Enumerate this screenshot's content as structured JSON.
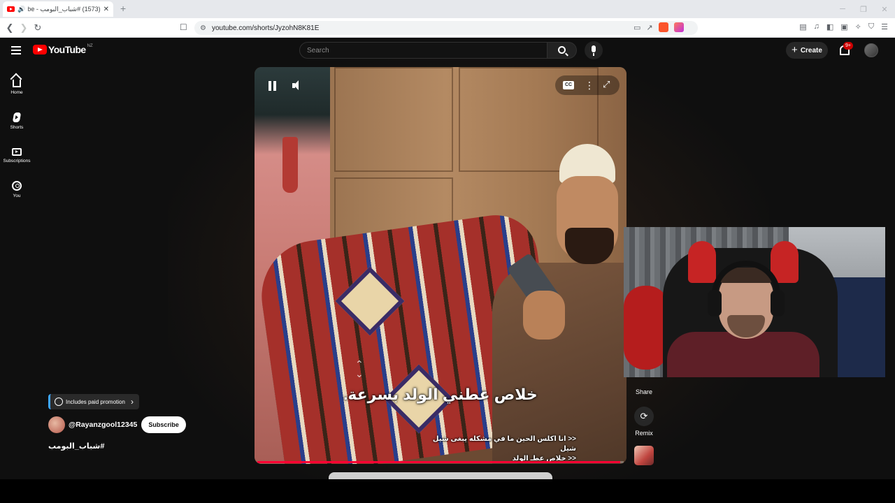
{
  "browser": {
    "tab_title": "(1573) #شباب_البومب - YouTube",
    "url": "youtube.com/shorts/JyzohN8K81E",
    "new_tab": "+",
    "tab_close": "✕"
  },
  "youtube": {
    "logo_text": "YouTube",
    "country_code": "NZ",
    "search_placeholder": "Search",
    "create_label": "Create",
    "notification_count": "9+",
    "sidebar": [
      {
        "label": "Home",
        "icon": "home-icon"
      },
      {
        "label": "Shorts",
        "icon": "shorts-icon"
      },
      {
        "label": "Subscriptions",
        "icon": "subscriptions-icon"
      },
      {
        "label": "You",
        "icon": "you-icon"
      }
    ]
  },
  "short": {
    "subtitle_large": "خلاص عطني الولد بسرعة.",
    "caption_line_1": "<< انا اكلس الحين ما في مشكله يبغى شيل شيل",
    "caption_line_2": "<< خلاص عطـ الولد",
    "progress_fraction": 0.99,
    "cc_label": "CC",
    "paid_promotion": "Includes paid promotion",
    "channel_name": "@Rayanzgool12345",
    "subscribe_label": "Subscribe",
    "hashtag": "#شباب_البومب"
  },
  "actions": {
    "share_label": "Share",
    "remix_label": "Remix"
  },
  "colors": {
    "youtube_red": "#ff0000",
    "progress_red": "#ff0033",
    "page_bg": "#0f0f0f"
  }
}
